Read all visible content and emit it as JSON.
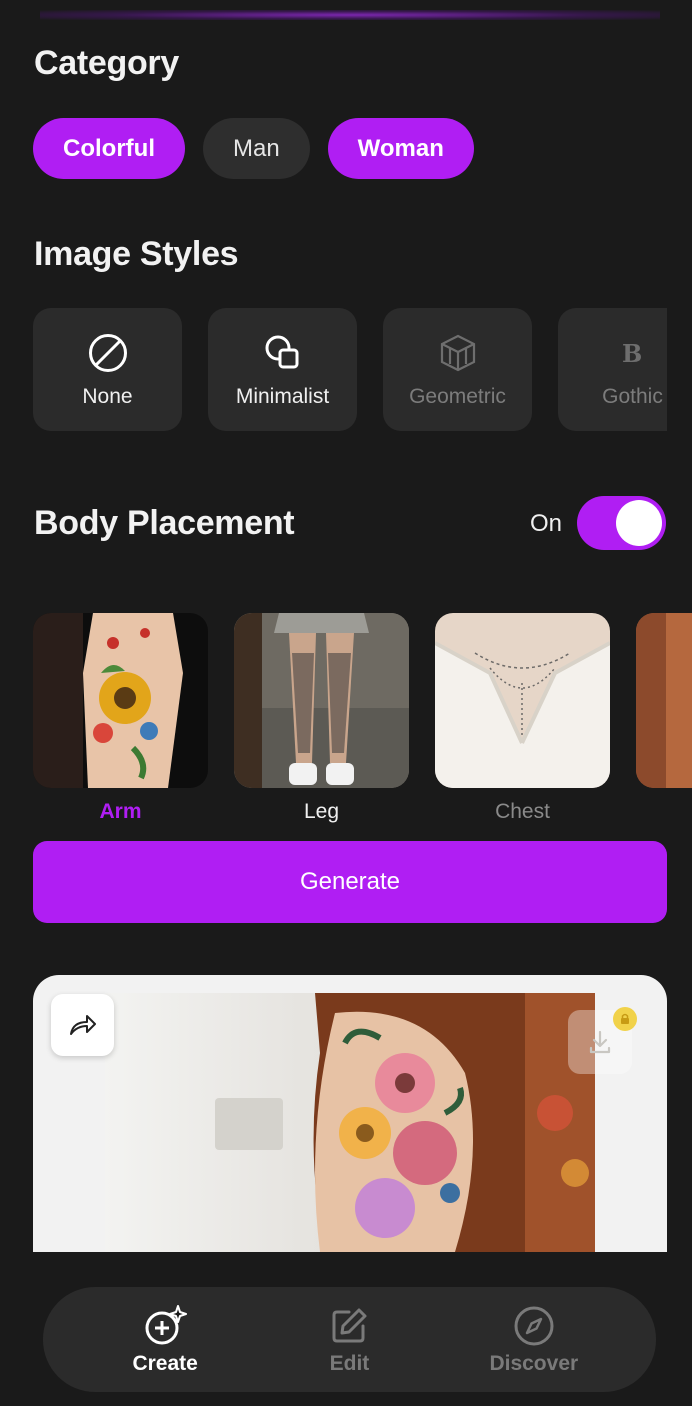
{
  "category": {
    "title": "Category",
    "chips": [
      {
        "label": "Colorful",
        "active": true
      },
      {
        "label": "Man",
        "active": false
      },
      {
        "label": "Woman",
        "active": true
      }
    ]
  },
  "image_styles": {
    "title": "Image Styles",
    "items": [
      {
        "label": "None",
        "icon": "none-circle-slash-icon"
      },
      {
        "label": "Minimalist",
        "icon": "minimalist-shapes-icon"
      },
      {
        "label": "Geometric",
        "icon": "geometric-cube-icon"
      },
      {
        "label": "Gothic",
        "icon": "gothic-letter-icon"
      }
    ]
  },
  "body_placement": {
    "title": "Body Placement",
    "toggle_label": "On",
    "toggle_on": true,
    "items": [
      {
        "label": "Arm",
        "selected": true
      },
      {
        "label": "Leg",
        "selected": false
      },
      {
        "label": "Chest",
        "selected": false
      }
    ]
  },
  "generate": {
    "label": "Generate"
  },
  "colors": {
    "accent": "#b01ef3",
    "background": "#1a1a1a",
    "card": "#2b2b2b",
    "lock": "#f1d24a"
  },
  "nav": {
    "items": [
      {
        "label": "Create",
        "icon": "create-sparkle-icon",
        "active": true
      },
      {
        "label": "Edit",
        "icon": "edit-pencil-icon",
        "active": false
      },
      {
        "label": "Discover",
        "icon": "compass-icon",
        "active": false
      }
    ]
  }
}
